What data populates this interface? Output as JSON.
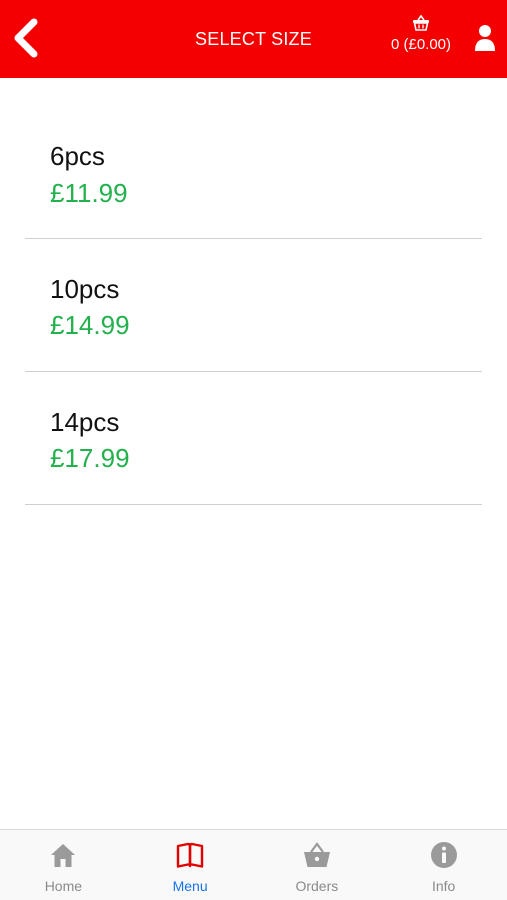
{
  "header": {
    "title": "SELECT SIZE",
    "cart_summary": "0 (£0.00)",
    "back_icon": "chevron-left-icon",
    "cart_icon": "basket-icon",
    "user_icon": "user-icon"
  },
  "sizes": [
    {
      "name": "6pcs",
      "price": "£11.99"
    },
    {
      "name": "10pcs",
      "price": "£14.99"
    },
    {
      "name": "14pcs",
      "price": "£17.99"
    }
  ],
  "tabs": [
    {
      "label": "Home",
      "icon": "home-icon",
      "active": false
    },
    {
      "label": "Menu",
      "icon": "book-icon",
      "active": true
    },
    {
      "label": "Orders",
      "icon": "basket-icon",
      "active": false
    },
    {
      "label": "Info",
      "icon": "info-icon",
      "active": false
    }
  ],
  "colors": {
    "header_bg": "#f50000",
    "price": "#22b14c",
    "active_tab_label": "#1a73e8",
    "active_tab_icon": "#e00000",
    "inactive": "#8a8a8a"
  }
}
